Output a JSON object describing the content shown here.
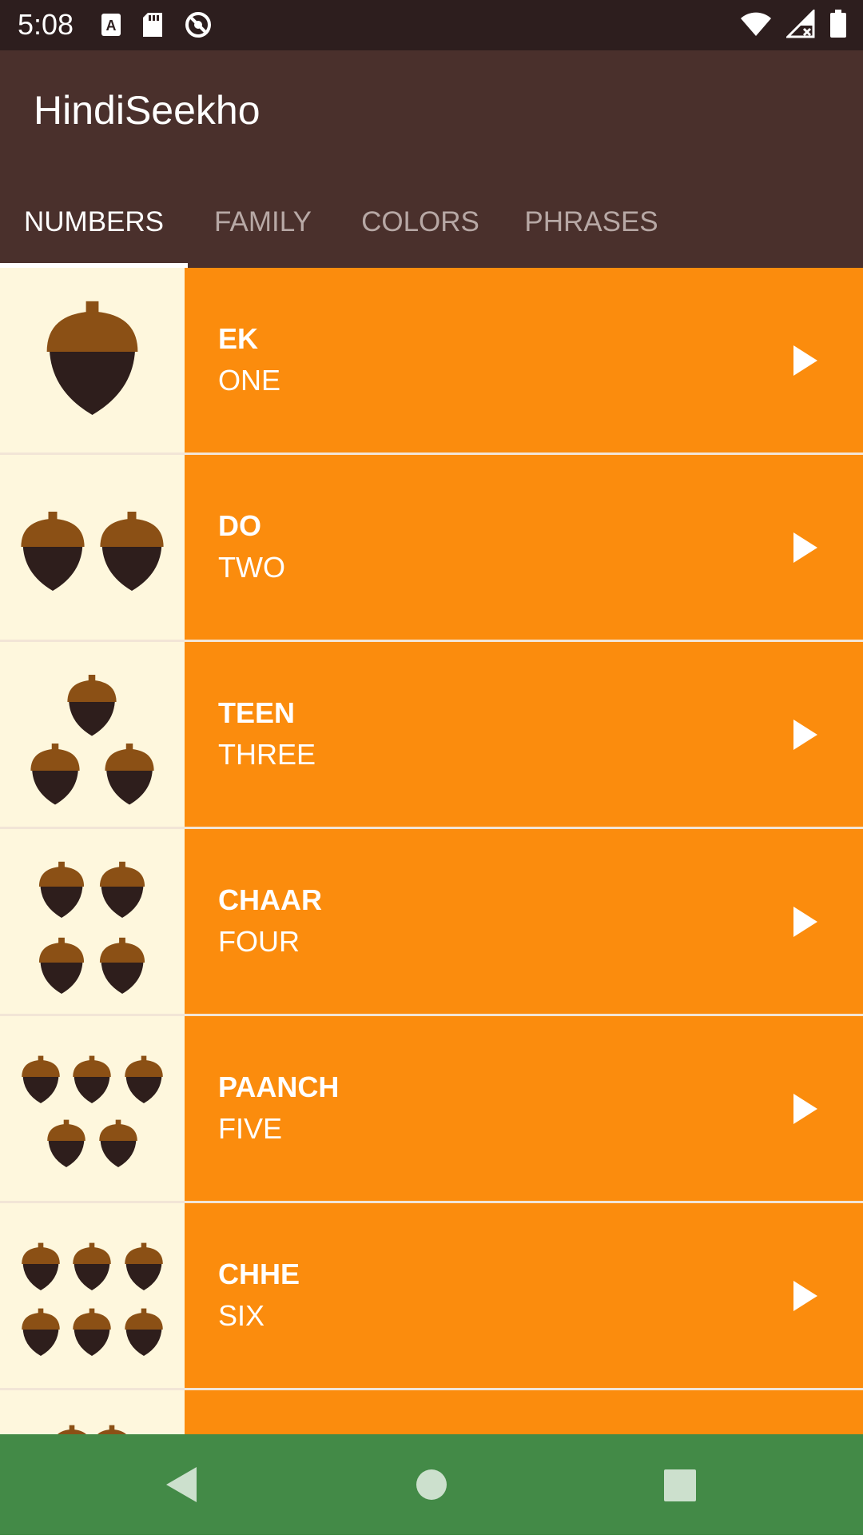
{
  "status_bar": {
    "time": "5:08",
    "left_icons": [
      "font-a-icon",
      "sd-card-icon",
      "no-sync-icon"
    ],
    "right_icons": [
      "wifi-icon",
      "signal-icon",
      "battery-icon"
    ]
  },
  "app_bar": {
    "title": "HindiSeekho"
  },
  "tabs": [
    {
      "label": "NUMBERS",
      "active": true
    },
    {
      "label": "FAMILY",
      "active": false
    },
    {
      "label": "COLORS",
      "active": false
    },
    {
      "label": "PHRASES",
      "active": false
    }
  ],
  "numbers": [
    {
      "hindi": "EK",
      "english": "ONE",
      "icon": "acorn-one-icon",
      "acorn_count": 1
    },
    {
      "hindi": "DO",
      "english": "TWO",
      "icon": "acorn-two-icon",
      "acorn_count": 2
    },
    {
      "hindi": "TEEN",
      "english": "THREE",
      "icon": "acorn-three-icon",
      "acorn_count": 3
    },
    {
      "hindi": "CHAAR",
      "english": "FOUR",
      "icon": "acorn-four-icon",
      "acorn_count": 4
    },
    {
      "hindi": "PAANCH",
      "english": "FIVE",
      "icon": "acorn-five-icon",
      "acorn_count": 5
    },
    {
      "hindi": "CHHE",
      "english": "SIX",
      "icon": "acorn-six-icon",
      "acorn_count": 6
    }
  ],
  "partial_row": {
    "icon": "acorn-seven-icon"
  },
  "nav_bar": {
    "buttons": [
      "back-triangle-icon",
      "home-circle-icon",
      "recents-square-icon"
    ]
  },
  "colors": {
    "status_bar": "#2d1e1e",
    "app_bar": "#4a302c",
    "row_background": "#fb8c0d",
    "image_background": "#fef7dd",
    "nav_bar": "#438a47",
    "acorn_cap": "#8b5015",
    "acorn_body": "#2e1e1c"
  }
}
